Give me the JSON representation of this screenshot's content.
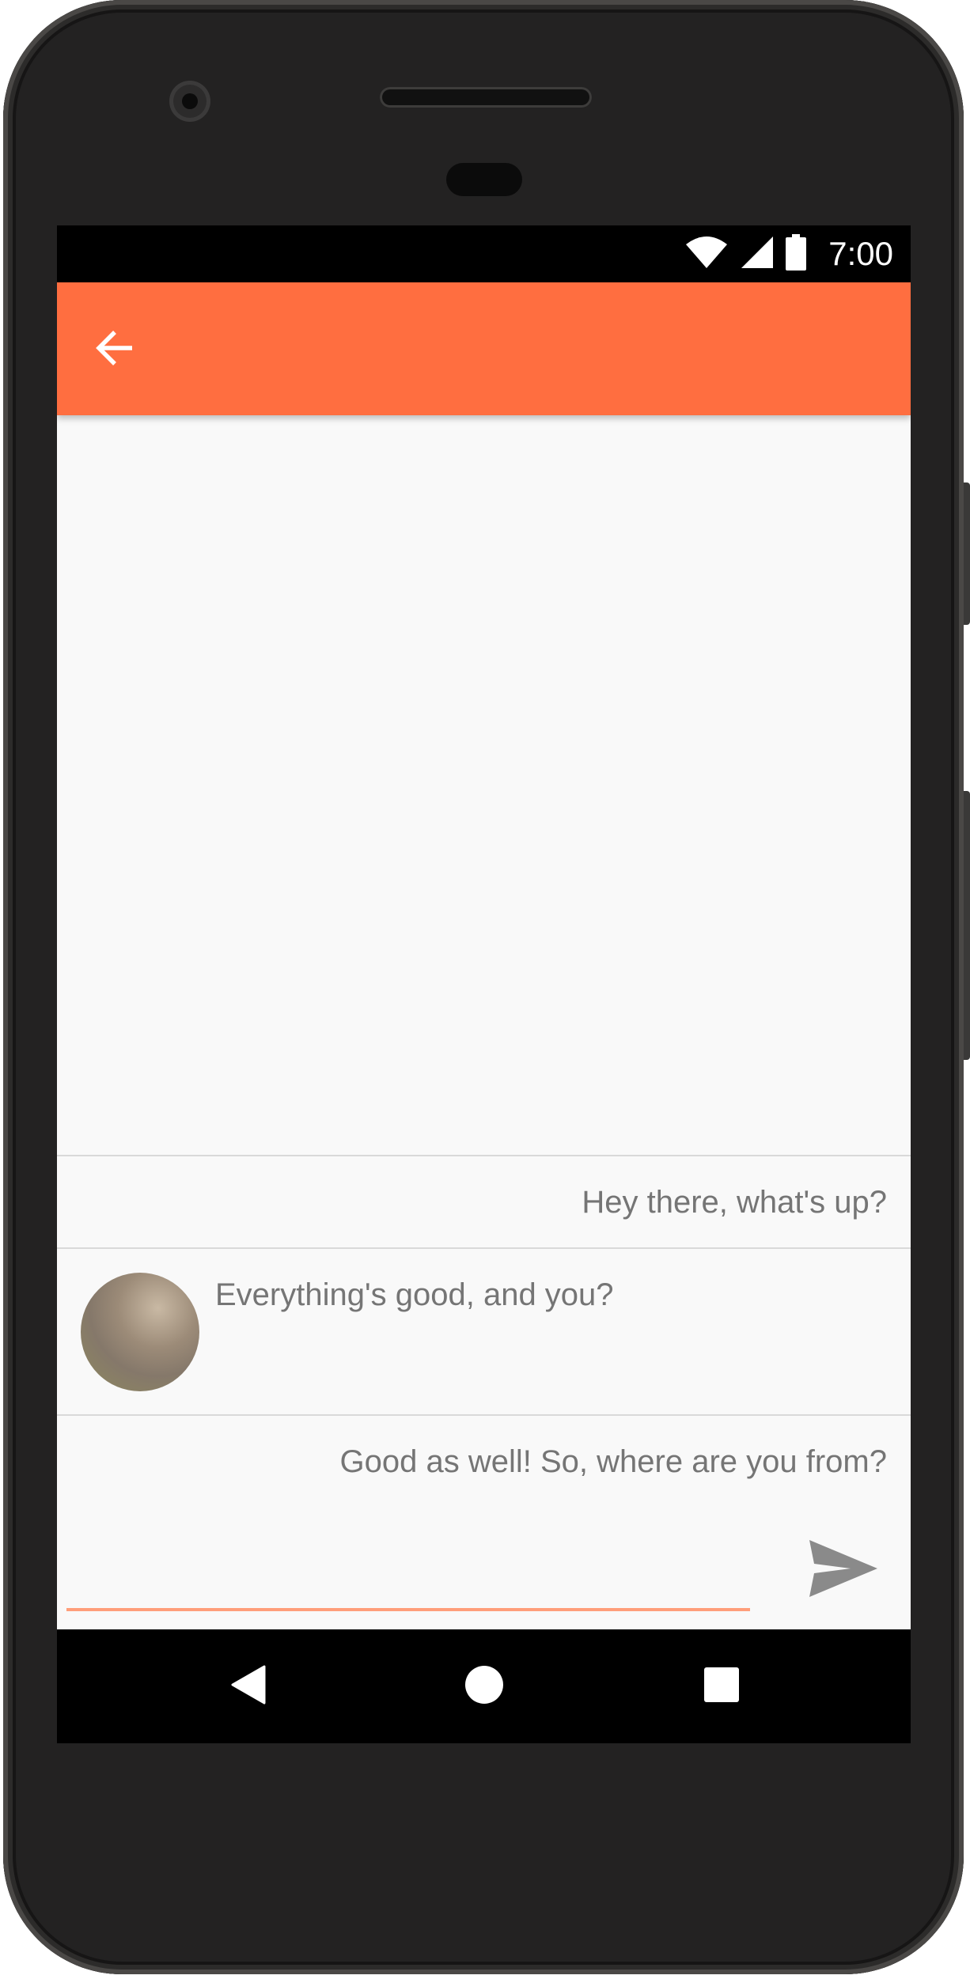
{
  "status_bar": {
    "time": "7:00",
    "icons": [
      "wifi-icon",
      "cell-signal-icon",
      "battery-icon"
    ]
  },
  "app_bar": {
    "back_icon": "arrow-back-icon",
    "color": "#ff6e40"
  },
  "messages": [
    {
      "side": "right",
      "text": "Hey there, what's up?"
    },
    {
      "side": "left",
      "text": "Everything's good, and you?",
      "avatar": true
    },
    {
      "side": "right",
      "text": "Good as well! So, where are you from?"
    }
  ],
  "composer": {
    "value": "",
    "send_icon": "send-icon",
    "accent": "#ff9e7a"
  },
  "nav_bar": {
    "buttons": [
      "back-nav-icon",
      "home-nav-icon",
      "recents-nav-icon"
    ]
  }
}
